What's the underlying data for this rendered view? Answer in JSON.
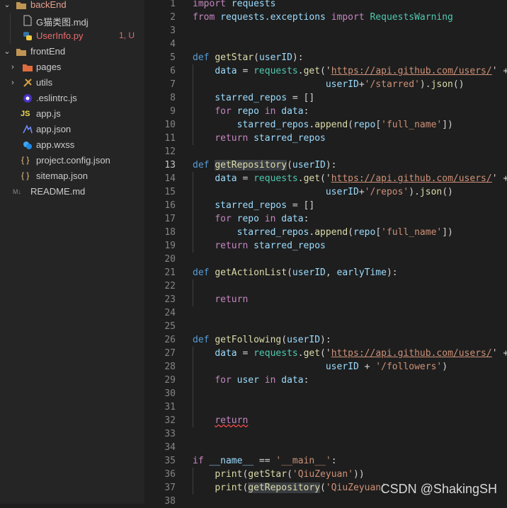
{
  "explorer": {
    "backend_folder": "backEnd",
    "backend_files": [
      {
        "name": "G猫类图.mdj",
        "icon": "file-icon"
      },
      {
        "name": "UserInfo.py",
        "icon": "python-icon",
        "status": "1, U"
      }
    ],
    "frontend_folder": "frontEnd",
    "frontend_items": [
      {
        "name": "pages",
        "icon": "pages-folder-icon"
      },
      {
        "name": "utils",
        "icon": "utils-folder-icon"
      },
      {
        "name": ".eslintrc.js",
        "icon": "eslint-icon"
      },
      {
        "name": "app.js",
        "icon": "js-icon"
      },
      {
        "name": "app.json",
        "icon": "json-icon"
      },
      {
        "name": "app.wxss",
        "icon": "wxss-icon"
      },
      {
        "name": "project.config.json",
        "icon": "braces-icon"
      },
      {
        "name": "sitemap.json",
        "icon": "braces-icon"
      }
    ],
    "readme": {
      "name": "README.md",
      "icon": "markdown-icon"
    },
    "js_badge": "JS",
    "md_badge": "M↓"
  },
  "editor": {
    "line_numbers": [
      "1",
      "2",
      "3",
      "4",
      "5",
      "6",
      "7",
      "8",
      "9",
      "10",
      "11",
      "12",
      "13",
      "14",
      "15",
      "16",
      "17",
      "18",
      "19",
      "20",
      "21",
      "22",
      "23",
      "24",
      "25",
      "26",
      "27",
      "28",
      "29",
      "30",
      "31",
      "32",
      "33",
      "34",
      "35",
      "36",
      "37",
      "38"
    ],
    "active_line": "13",
    "code": {
      "l1_a": "import",
      "l1_b": " requests",
      "l2_a": "from",
      "l2_b": " requests.exceptions ",
      "l2_c": "import",
      "l2_d": " RequestsWarning",
      "def": "def",
      "fn_star": "getStar",
      "fn_repo": "getRepository",
      "fn_action": "getActionList",
      "fn_follow": "getFollowing",
      "userID": "userID",
      "earlyTime": "earlyTime",
      "data": "data",
      "requests": "requests",
      "get": "get",
      "url": "https://api.github.com/users/",
      "plus": " +",
      "starred_suffix": "'/starred'",
      "repos_suffix": "'/repos'",
      "followers_suffix": "'/followers'",
      "json": "json",
      "starred_repos": "starred_repos",
      "append": "append",
      "for": "for",
      "repo": "repo",
      "in": "in",
      "user": "user",
      "full_name": "'full_name'",
      "return": "return",
      "if": "if",
      "name_dunder": "__name__",
      "main_str": "'__main__'",
      "print": "print",
      "qiu": "'QiuZeyuan'",
      "qiu2": "'QiuZeyuan'"
    }
  },
  "watermark": "CSDN @ShakingSH"
}
